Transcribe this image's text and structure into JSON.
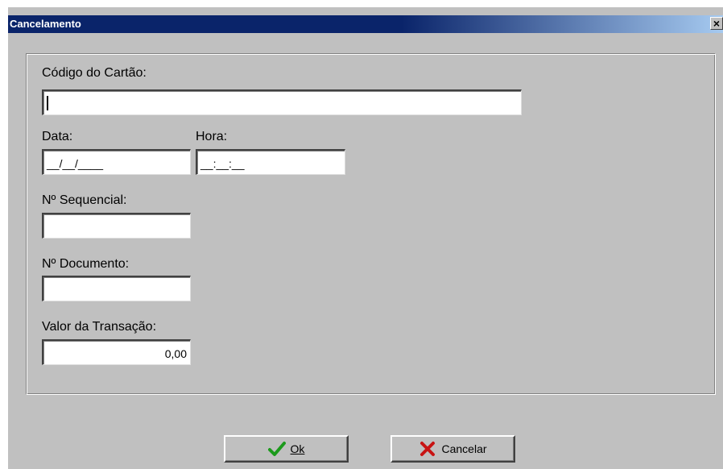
{
  "window": {
    "title": "Cancelamento",
    "close_glyph": "×"
  },
  "form": {
    "card_code_label": "Código do Cartão:",
    "card_code_value": "",
    "date_label": "Data:",
    "date_value": "__/__/____",
    "time_label": "Hora:",
    "time_value": "__:__:__",
    "sequence_label": "Nº Sequencial:",
    "sequence_value": "",
    "document_label": "Nº Documento:",
    "document_value": "",
    "amount_label": "Valor da Transação:",
    "amount_value": "0,00"
  },
  "buttons": {
    "ok_label": "Ok",
    "ok_icon": "check-icon",
    "cancel_label": "Cancelar",
    "cancel_icon": "x-icon"
  },
  "colors": {
    "titlebar_start": "#0a246a",
    "titlebar_end": "#a6caf0",
    "dialog_bg": "#c0c0c0",
    "check_green": "#1c9a1c",
    "x_red": "#c81414"
  }
}
